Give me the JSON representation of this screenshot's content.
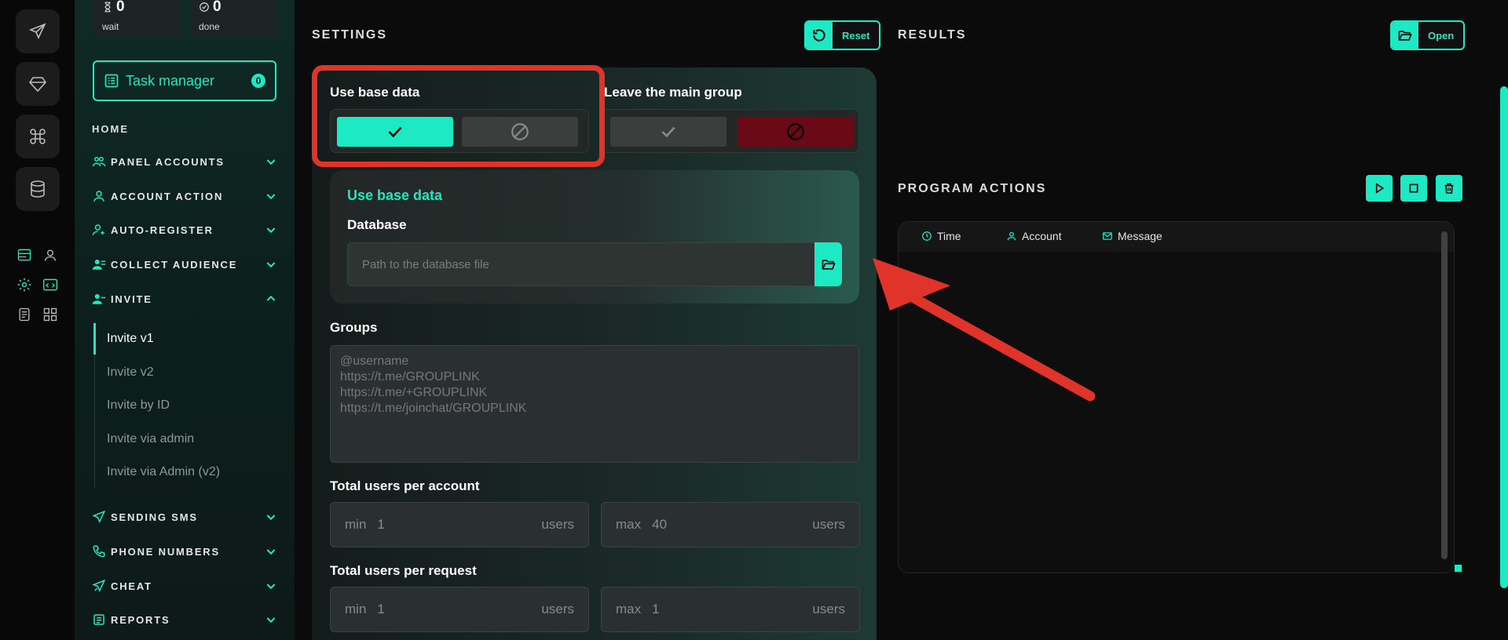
{
  "rail": {
    "icons": [
      "send-icon",
      "diamond-icon",
      "command-icon",
      "database-icon"
    ]
  },
  "stats": {
    "wait": {
      "count": "0",
      "label": "wait"
    },
    "done": {
      "count": "0",
      "label": "done"
    }
  },
  "task_manager": {
    "label": "Task manager",
    "badge": "0"
  },
  "nav": {
    "home": "HOME",
    "items": [
      {
        "label": "PANEL ACCOUNTS",
        "icon": "users-icon"
      },
      {
        "label": "ACCOUNT ACTION",
        "icon": "user-icon"
      },
      {
        "label": "AUTO-REGISTER",
        "icon": "user-plus-icon"
      },
      {
        "label": "COLLECT AUDIENCE",
        "icon": "user-list-icon"
      },
      {
        "label": "INVITE",
        "icon": "user-invite-icon"
      },
      {
        "label": "SENDING SMS",
        "icon": "send-icon"
      },
      {
        "label": "PHONE NUMBERS",
        "icon": "phone-icon"
      },
      {
        "label": "CHEAT",
        "icon": "cheat-icon"
      },
      {
        "label": "REPORTS",
        "icon": "report-icon"
      }
    ],
    "invite_sub": [
      "Invite v1",
      "Invite v2",
      "Invite by ID",
      "Invite via admin",
      "Invite via Admin (v2)"
    ]
  },
  "settings": {
    "title": "SETTINGS",
    "reset_label": "Reset",
    "use_base_data": {
      "label": "Use base data",
      "selected": "yes"
    },
    "leave_main_group": {
      "label": "Leave the main group",
      "selected": "no"
    },
    "base_card": {
      "title": "Use base data",
      "database_label": "Database",
      "database_placeholder": "Path to the database file"
    },
    "groups": {
      "label": "Groups",
      "placeholder": "@username\nhttps://t.me/GROUPLINK\nhttps://t.me/+GROUPLINK\nhttps://t.me/joinchat/GROUPLINK"
    },
    "users_per_account": {
      "label": "Total users per account",
      "min_prefix": "min",
      "min": "1",
      "max_prefix": "max",
      "max": "40",
      "unit": "users"
    },
    "users_per_request": {
      "label": "Total users per request",
      "min_prefix": "min",
      "min": "1",
      "max_prefix": "max",
      "max": "1",
      "unit": "users"
    }
  },
  "results": {
    "title": "RESULTS",
    "open_label": "Open"
  },
  "program_actions": {
    "title": "PROGRAM ACTIONS",
    "columns": [
      "Time",
      "Account",
      "Message"
    ]
  },
  "colors": {
    "accent": "#1de9c4",
    "danger": "#6b0a16",
    "annotation": "#e0342b"
  }
}
